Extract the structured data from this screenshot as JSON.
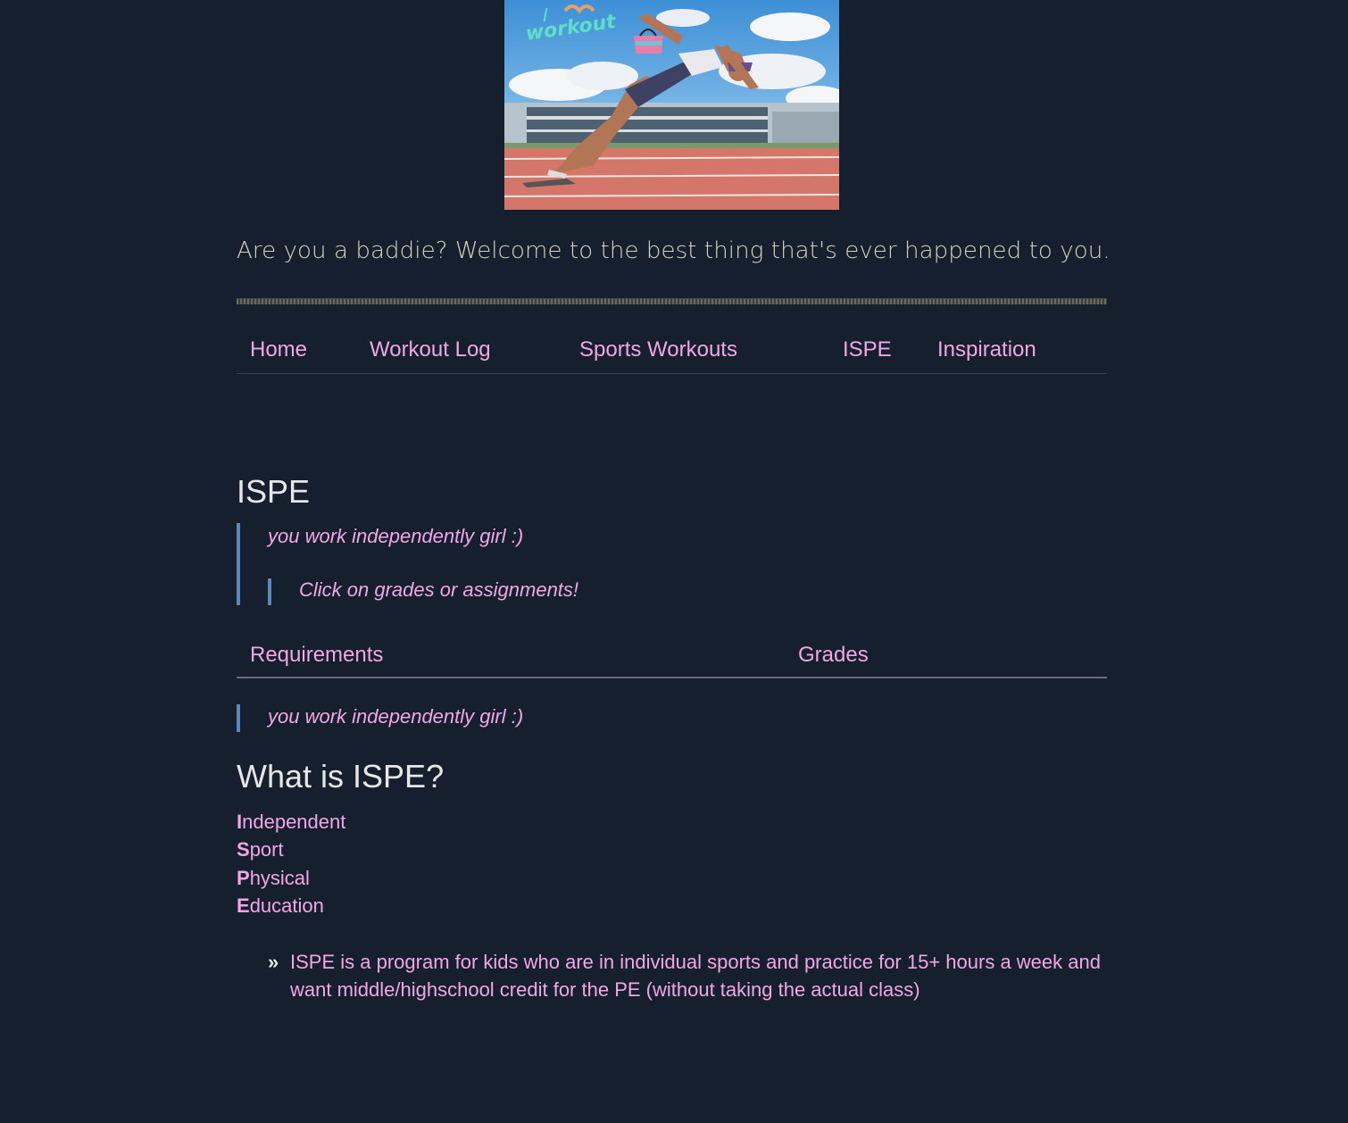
{
  "hero": {
    "image_text": "I workout",
    "image_alt": "Sprinter starting from blocks on a running track"
  },
  "tagline": "Are you a baddie? Welcome to the best thing that's ever happened to you.",
  "nav": {
    "items": [
      {
        "label": "Home"
      },
      {
        "label": "Workout Log"
      },
      {
        "label": "Sports Workouts"
      },
      {
        "label": "ISPE"
      },
      {
        "label": "Inspiration"
      }
    ]
  },
  "page": {
    "title": "ISPE",
    "quote_outer": "you work independently girl :)",
    "quote_inner": "Click on grades or assignments!"
  },
  "tabs": {
    "items": [
      {
        "label": "Requirements"
      },
      {
        "label": "Grades"
      }
    ]
  },
  "tab_content": {
    "quote": "you work independently girl :)"
  },
  "section": {
    "title": "What is ISPE?",
    "acronym": [
      {
        "initial": "I",
        "rest": "ndependent"
      },
      {
        "initial": "S",
        "rest": "port"
      },
      {
        "initial": "P",
        "rest": "hysical"
      },
      {
        "initial": "E",
        "rest": "ducation"
      }
    ],
    "bullet_mark": "»",
    "bullet_text": "ISPE is a program for kids who are in individual sports and practice for 15+ hours a week and want middle/highschool credit for the PE (without taking the actual class)"
  },
  "colors": {
    "background": "#151f2d",
    "link": "#f1a7e6",
    "heading": "#e7e7e7",
    "tagline": "#d8d3c1",
    "quote_border": "#5c87b8"
  }
}
